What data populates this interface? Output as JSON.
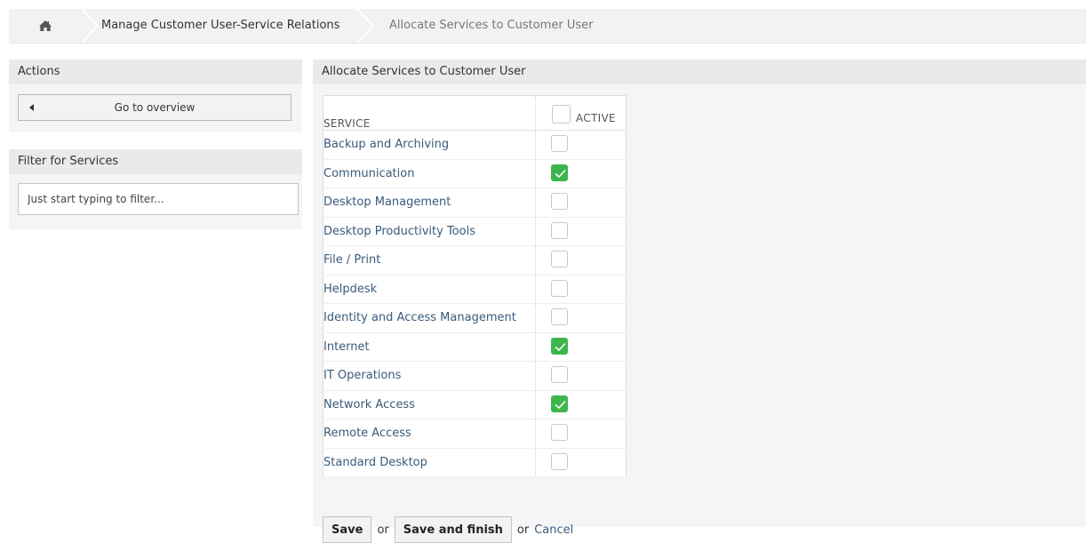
{
  "breadcrumb": {
    "home_icon": "home-icon",
    "items": [
      {
        "label": "Manage Customer User-Service Relations"
      },
      {
        "label": "Allocate Services to Customer User"
      }
    ]
  },
  "sidebar": {
    "actions": {
      "title": "Actions",
      "overview_button": "Go to overview"
    },
    "filter": {
      "title": "Filter for Services",
      "placeholder": "Just start typing to filter..."
    }
  },
  "main": {
    "title": "Allocate Services to Customer User",
    "table": {
      "columns": [
        "SERVICE",
        "ACTIVE"
      ],
      "rows": [
        {
          "service": "Backup and Archiving",
          "active": false
        },
        {
          "service": "Communication",
          "active": true
        },
        {
          "service": "Desktop Management",
          "active": false
        },
        {
          "service": "Desktop Productivity Tools",
          "active": false
        },
        {
          "service": "File / Print",
          "active": false
        },
        {
          "service": "Helpdesk",
          "active": false
        },
        {
          "service": "Identity and Access Management",
          "active": false
        },
        {
          "service": "Internet",
          "active": true
        },
        {
          "service": "IT Operations",
          "active": false
        },
        {
          "service": "Network Access",
          "active": true
        },
        {
          "service": "Remote Access",
          "active": false
        },
        {
          "service": "Standard Desktop",
          "active": false
        }
      ]
    },
    "footer": {
      "save": "Save",
      "or1": "or",
      "save_finish": "Save and finish",
      "or2": "or",
      "cancel": "Cancel"
    }
  },
  "colors": {
    "check_green": "#3cb64c",
    "link_blue": "#3a5a7a"
  }
}
